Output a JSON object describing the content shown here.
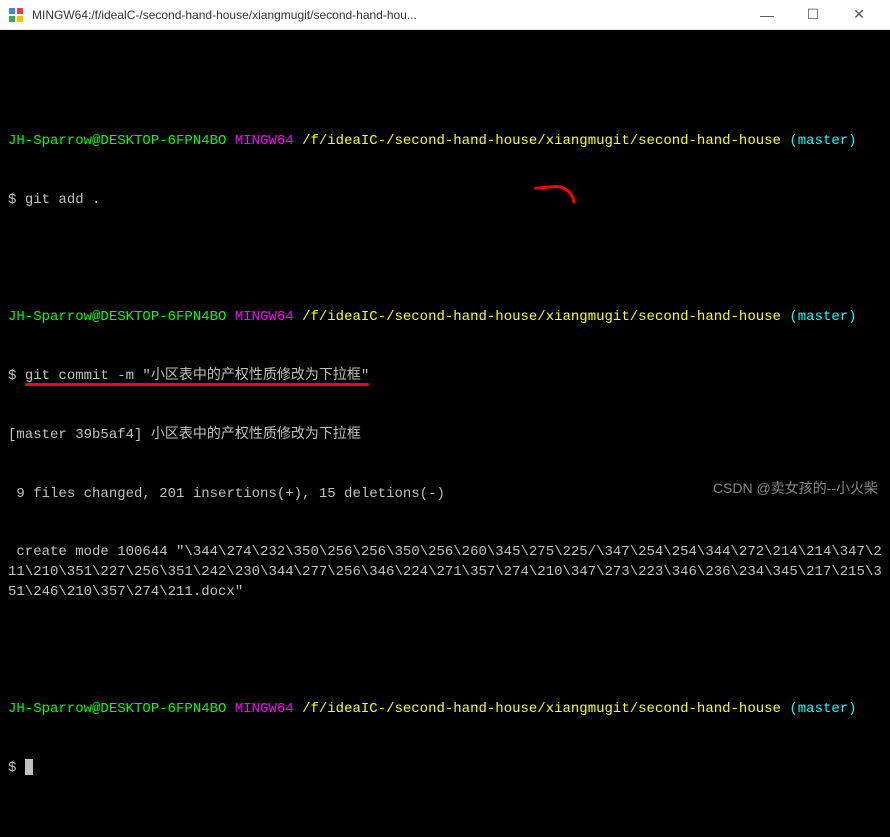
{
  "window": {
    "title": "MINGW64:/f/idealC-/second-hand-house/xiangmugit/second-hand-hou...",
    "minimize": "—",
    "maximize": "☐",
    "close": "✕"
  },
  "prompt": {
    "user_host": "JH-Sparrow@DESKTOP-6FPN4BO",
    "env": "MINGW64",
    "path": "/f/ideaIC-/second-hand-house/xiangmugit/second-hand-house",
    "branch": "(master)",
    "symbol": "$"
  },
  "cmd1": "git add .",
  "cmd2": "git commit -m \"小区表中的产权性质修改为下拉框\"",
  "output": {
    "line1": "[master 39b5af4] 小区表中的产权性质修改为下拉框",
    "line2": " 9 files changed, 201 insertions(+), 15 deletions(-)",
    "line3": " create mode 100644 \"\\344\\274\\232\\350\\256\\256\\350\\256\\260\\345\\275\\225/\\347\\254\\254\\344\\272\\214\\214\\347\\211\\210\\351\\227\\256\\351\\242\\230\\344\\277\\256\\346\\224\\271\\357\\274\\210\\347\\273\\223\\346\\236\\234\\345\\217\\215\\351\\246\\210\\357\\274\\211.docx\""
  },
  "watermark": "CSDN @卖女孩的--小火柴"
}
